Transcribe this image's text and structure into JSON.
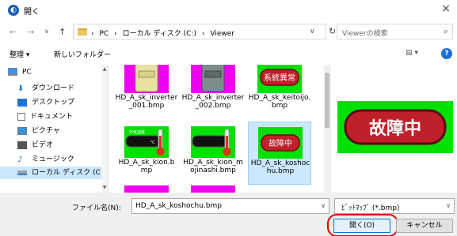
{
  "window": {
    "title": "開く",
    "close": "×"
  },
  "nav": {
    "back": "←",
    "forward": "→",
    "up": "↑",
    "breadcrumbs": [
      "PC",
      "ローカル ディスク (C:)",
      "Viewer"
    ],
    "separator": "›",
    "dropdown": "∨",
    "refresh": "↻",
    "search_placeholder": "Viewerの検索"
  },
  "toolbar": {
    "organize": "整理 ▾",
    "new_folder": "新しいフォルダー",
    "view": "▤ ▾",
    "help": "?"
  },
  "sidebar": {
    "items": [
      {
        "label": "PC",
        "icon": "pc-icon"
      },
      {
        "label": "ダウンロード",
        "icon": "download-icon"
      },
      {
        "label": "デスクトップ",
        "icon": "desktop-icon"
      },
      {
        "label": "ドキュメント",
        "icon": "documents-icon"
      },
      {
        "label": "ピクチャ",
        "icon": "pictures-icon"
      },
      {
        "label": "ビデオ",
        "icon": "videos-icon"
      },
      {
        "label": "ミュージック",
        "icon": "music-icon"
      },
      {
        "label": "ローカル ディスク (C",
        "icon": "drive-icon"
      }
    ]
  },
  "files": [
    {
      "name": "HD_A_sk_inverter\n_001.bmp",
      "thumb": "inverter-yellow"
    },
    {
      "name": "HD_A_sk_inverter\n_002.bmp",
      "thumb": "inverter-gray"
    },
    {
      "name": "HD_A_sk_keitoijo.\nbmp",
      "thumb": "badge",
      "badge_text": "系統異常"
    },
    {
      "name": "HD_A_sk_kion.b\nmp",
      "thumb": "thermo",
      "thermo_text": "外気温度",
      "unit": "℃"
    },
    {
      "name": "HD_A_sk_kion_m\nojinashi.bmp",
      "thumb": "thermo"
    },
    {
      "name": "HD_A_sk_koshoc\nhu.bmp",
      "thumb": "badge",
      "badge_text": "故障中",
      "selected": true
    }
  ],
  "preview": {
    "text": "故障中"
  },
  "bottom": {
    "filename_label": "ファイル名(N):",
    "filename_value": "HD_A_sk_koshochu.bmp",
    "filter_value": "ﾋﾞｯﾄﾏｯﾌﾟ (*.bmp)",
    "open_label": "開く(O)",
    "cancel_label": "キャンセル"
  },
  "colors": {
    "magenta": "#f000f0",
    "green": "#00e000",
    "red_badge": "#c0202a",
    "accent": "#0078d7"
  }
}
